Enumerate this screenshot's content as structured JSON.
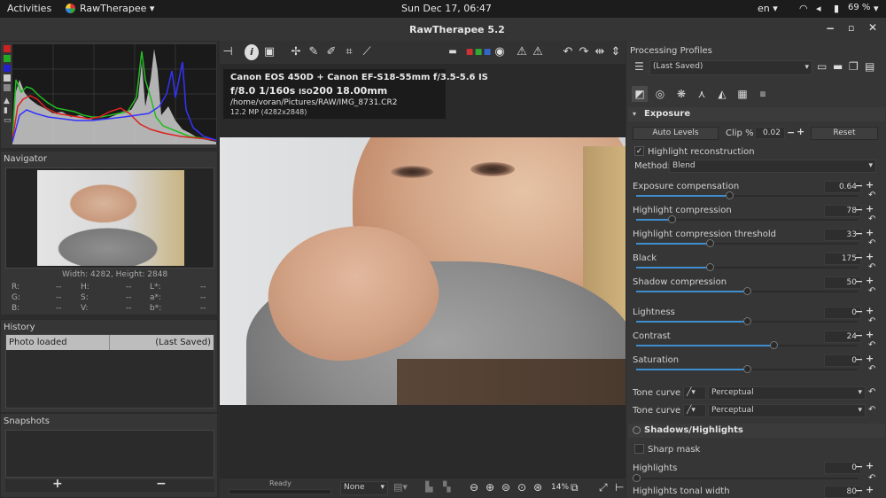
{
  "topbar": {
    "activities": "Activities",
    "app_name": "RawTherapee",
    "clock": "Sun Dec 17, 06:47",
    "lang": "en",
    "battery": "69 %"
  },
  "window": {
    "title": "RawTherapee 5.2"
  },
  "navigator": {
    "title": "Navigator",
    "size": "Width: 4282, Height: 2848",
    "r": "R:",
    "g": "G:",
    "b": "B:",
    "h": "H:",
    "s": "S:",
    "v": "V:",
    "l": "L*:",
    "a": "a*:",
    "bb": "b*:",
    "dash": "--"
  },
  "history": {
    "title": "History",
    "item": "Photo loaded",
    "item_state": "(Last Saved)"
  },
  "snapshots": {
    "title": "Snapshots",
    "add": "+",
    "remove": "−"
  },
  "exif": {
    "line1": "Canon EOS 450D + Canon EF-S18-55mm f/3.5-5.6 IS",
    "aperture": "f/8.0",
    "shutter": "1/160s",
    "iso_label": "ISO",
    "iso": "200",
    "focal": "18.00mm",
    "path": "/home/voran/Pictures/RAW/IMG_8731.CR2",
    "mp": "12.2 MP (4282x2848)"
  },
  "bottom": {
    "status": "Ready",
    "none": "None",
    "zoom": "14%"
  },
  "profiles": {
    "title": "Processing Profiles",
    "current": "(Last Saved)"
  },
  "exposure": {
    "title": "Exposure",
    "auto_levels": "Auto Levels",
    "clip_label": "Clip %",
    "clip": "0.02",
    "reset": "Reset",
    "hl_recon": "Highlight reconstruction",
    "method_label": "Method:",
    "method": "Blend",
    "sliders": [
      {
        "label": "Exposure compensation",
        "value": "0.64",
        "level": 0.42
      },
      {
        "label": "Highlight compression",
        "value": "78",
        "level": 0.16
      },
      {
        "label": "Highlight compression threshold",
        "value": "33",
        "level": 0.33
      },
      {
        "label": "Black",
        "value": "175",
        "level": 0.33
      },
      {
        "label": "Shadow compression",
        "value": "50",
        "level": 0.5
      },
      {
        "label": "Lightness",
        "value": "0",
        "level": 0.5
      },
      {
        "label": "Contrast",
        "value": "24",
        "level": 0.62
      },
      {
        "label": "Saturation",
        "value": "0",
        "level": 0.5
      }
    ],
    "tc1": "Tone curve 1:",
    "tc2": "Tone curve 2:",
    "perceptual": "Perceptual"
  },
  "shadows": {
    "title": "Shadows/Highlights",
    "sharp_mask": "Sharp mask",
    "highlights": "Highlights",
    "highlights_val": "0",
    "tonal": "Highlights tonal width",
    "tonal_val": "80",
    "highlights_level": 0.0
  },
  "colors": {
    "accent": "#3f8ecf"
  }
}
